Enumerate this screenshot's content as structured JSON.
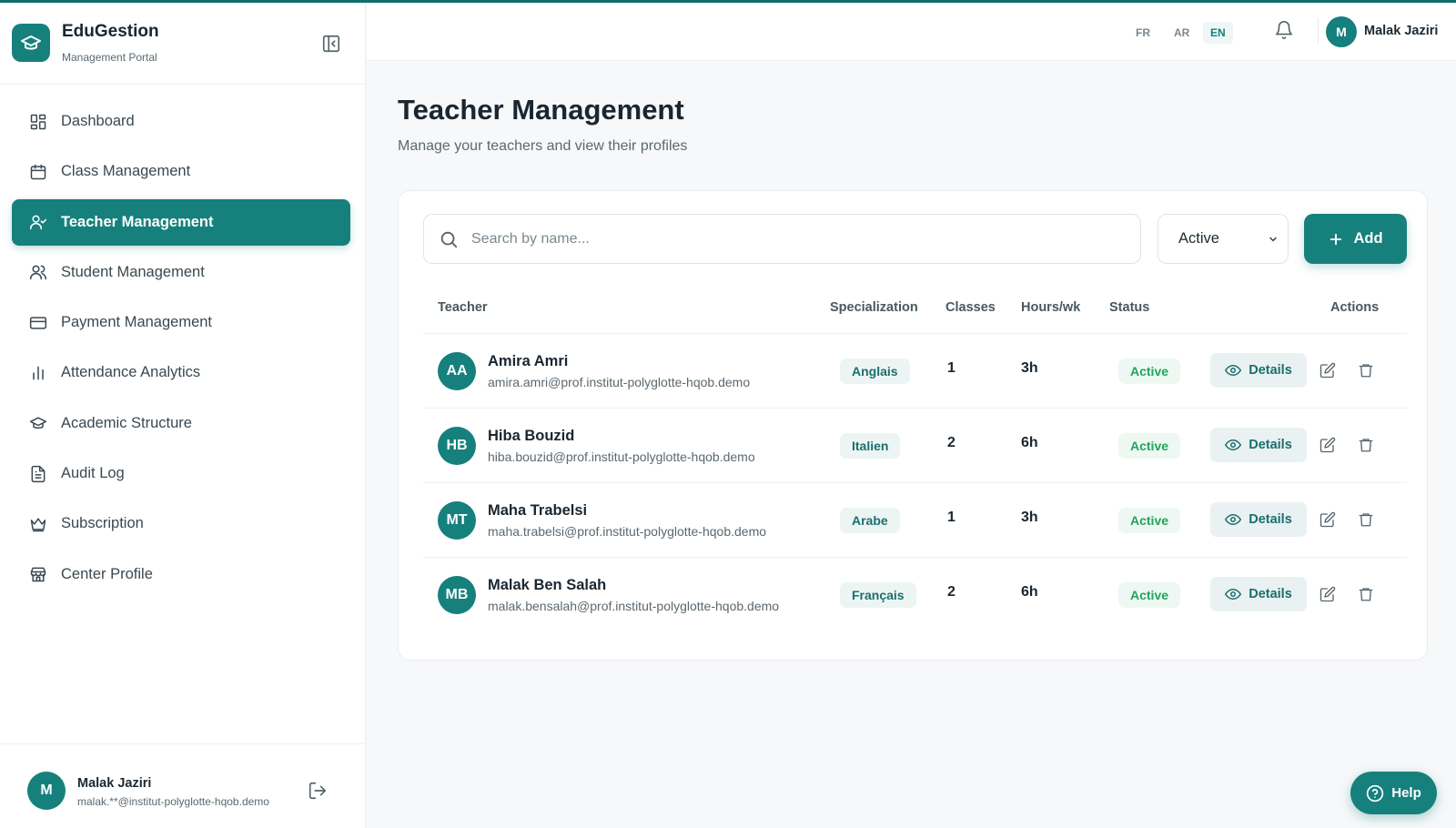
{
  "app": {
    "name": "EduGestion",
    "subtitle": "Management Portal",
    "accent_color": "#16807d"
  },
  "sidebar": {
    "items": [
      {
        "label": "Dashboard",
        "icon": "dashboard-grid-icon",
        "active": false
      },
      {
        "label": "Class Management",
        "icon": "calendar-icon",
        "active": false
      },
      {
        "label": "Teacher Management",
        "icon": "user-check-icon",
        "active": true
      },
      {
        "label": "Student Management",
        "icon": "users-icon",
        "active": false
      },
      {
        "label": "Payment Management",
        "icon": "credit-card-icon",
        "active": false
      },
      {
        "label": "Attendance Analytics",
        "icon": "bar-chart-icon",
        "active": false
      },
      {
        "label": "Academic Structure",
        "icon": "graduation-cap-icon",
        "active": false
      },
      {
        "label": "Audit Log",
        "icon": "file-text-icon",
        "active": false
      },
      {
        "label": "Subscription",
        "icon": "crown-icon",
        "active": false
      },
      {
        "label": "Center Profile",
        "icon": "store-icon",
        "active": false
      }
    ],
    "user": {
      "initial": "M",
      "name": "Malak Jaziri",
      "email": "malak.**@institut-polyglotte-hqob.demo"
    }
  },
  "header": {
    "languages": [
      "FR",
      "AR",
      "EN"
    ],
    "selected_language": "EN",
    "user_initial": "M",
    "user_name": "Malak Jaziri"
  },
  "main": {
    "title": "Teacher Management",
    "subtitle": "Manage your teachers and view their profiles",
    "search_placeholder": "Search by name...",
    "filter_value": "Active",
    "add_label": "Add",
    "columns": {
      "teacher": "Teacher",
      "specialization": "Specialization",
      "classes": "Classes",
      "hours": "Hours/wk",
      "status": "Status",
      "actions": "Actions"
    },
    "details_label": "Details",
    "teachers": [
      {
        "initials": "AA",
        "name": "Amira Amri",
        "email": "amira.amri@prof.institut-polyglotte-hqob.demo",
        "specialization": "Anglais",
        "classes": "1",
        "hours": "3h",
        "status": "Active"
      },
      {
        "initials": "HB",
        "name": "Hiba Bouzid",
        "email": "hiba.bouzid@prof.institut-polyglotte-hqob.demo",
        "specialization": "Italien",
        "classes": "2",
        "hours": "6h",
        "status": "Active"
      },
      {
        "initials": "MT",
        "name": "Maha Trabelsi",
        "email": "maha.trabelsi@prof.institut-polyglotte-hqob.demo",
        "specialization": "Arabe",
        "classes": "1",
        "hours": "3h",
        "status": "Active"
      },
      {
        "initials": "MB",
        "name": "Malak Ben Salah",
        "email": "malak.bensalah@prof.institut-polyglotte-hqob.demo",
        "specialization": "Français",
        "classes": "2",
        "hours": "6h",
        "status": "Active"
      }
    ]
  },
  "help_label": "Help"
}
